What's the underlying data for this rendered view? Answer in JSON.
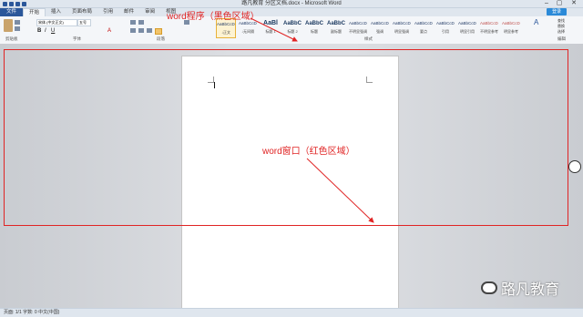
{
  "window": {
    "title": "路凡教育 分区文档.docx - Microsoft Word",
    "minimize": "–",
    "maximize": "▢",
    "close": "✕"
  },
  "tabs": [
    {
      "label": "文件"
    },
    {
      "label": "开始"
    },
    {
      "label": "插入"
    },
    {
      "label": "页面布局"
    },
    {
      "label": "引用"
    },
    {
      "label": "邮件"
    },
    {
      "label": "审阅"
    },
    {
      "label": "视图"
    }
  ],
  "login_label": "登录",
  "ribbon": {
    "groups": [
      "剪贴板",
      "字体",
      "段落",
      "样式",
      "编辑"
    ],
    "font_name": "宋体 (中文正文)",
    "font_size": "五号",
    "styles": [
      {
        "preview": "AaBbCcDd",
        "name": "↓正文"
      },
      {
        "preview": "AaBbCcDd",
        "name": "↓无间隔"
      },
      {
        "preview": "AaBl",
        "name": "标题 1"
      },
      {
        "preview": "AaBbC",
        "name": "标题 2"
      },
      {
        "preview": "AaBbC",
        "name": "标题"
      },
      {
        "preview": "AaBbC",
        "name": "副标题"
      },
      {
        "preview": "AaBbCcDd",
        "name": "不明显强调"
      },
      {
        "preview": "AaBbCcDd",
        "name": "强调"
      },
      {
        "preview": "AaBbCcDd",
        "name": "明显强调"
      },
      {
        "preview": "AaBbCcDd",
        "name": "要点"
      },
      {
        "preview": "AaBbCcDd",
        "name": "引用"
      },
      {
        "preview": "AaBbCcDd",
        "name": "明显引用"
      },
      {
        "preview": "AaBbCcDd",
        "name": "不明显参考"
      },
      {
        "preview": "AaBbCcDd",
        "name": "明显参考"
      }
    ],
    "edit_items": [
      "查找",
      "替换",
      "选择"
    ]
  },
  "annotations": {
    "program": "word程序（黑色区域）",
    "window": "word窗口（红色区域）"
  },
  "statusbar": {
    "text": "页面: 1/1   字数: 0   中文(中国)"
  },
  "watermark": "路凡教育",
  "colors": {
    "accent": "#2b579a",
    "annotation": "#e02424"
  }
}
